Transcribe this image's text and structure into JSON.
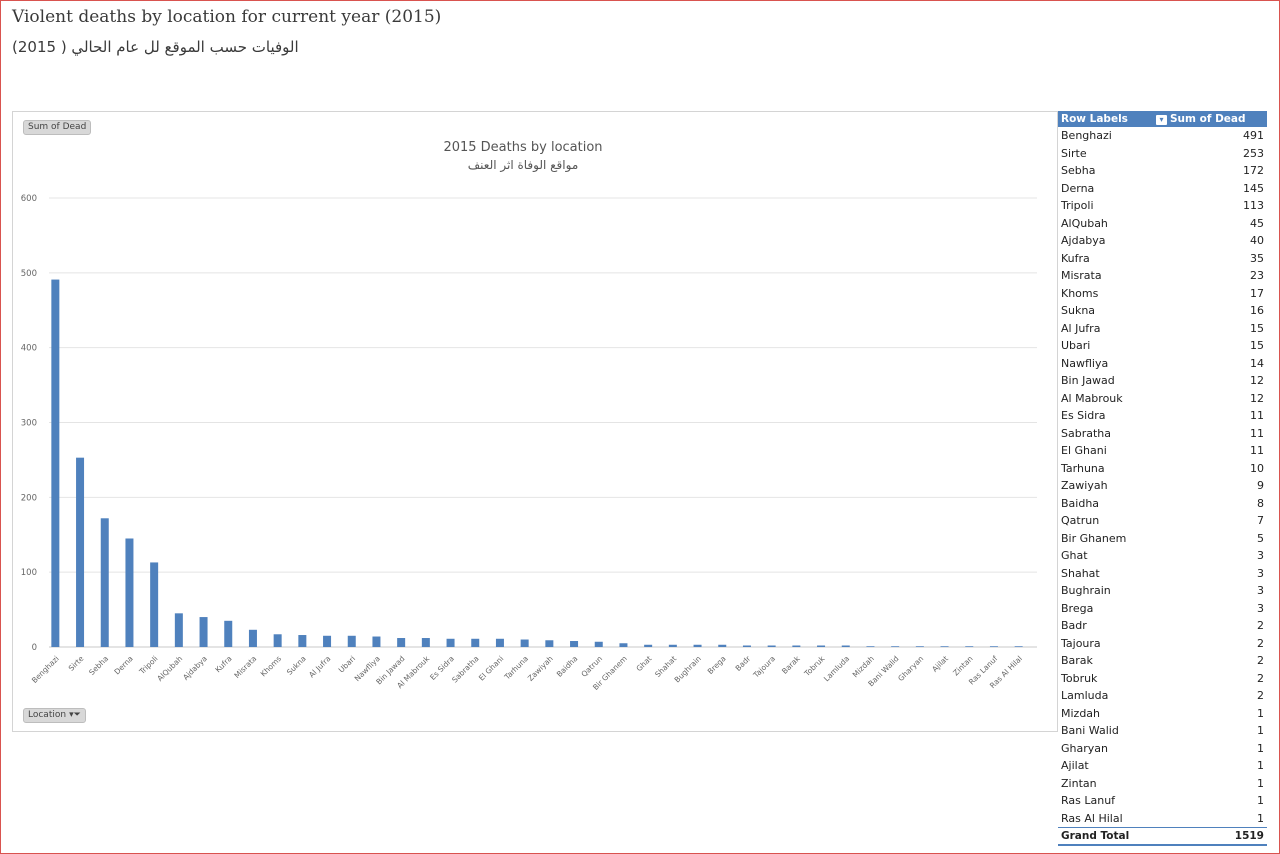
{
  "page": {
    "title": "Violent deaths by location for current year (2015)",
    "subtitle": "الوفيات حسب الموقع لل عام الحالي ( 2015)"
  },
  "chart_controls": {
    "value_field": "Sum of Dead",
    "axis_field": "Location"
  },
  "chart_data": {
    "type": "bar",
    "title": "2015 Deaths by location",
    "subtitle": "مواقع الوفاة اثر العنف",
    "xlabel": "",
    "ylabel": "",
    "ylim": [
      0,
      600
    ],
    "yticks": [
      0,
      100,
      200,
      300,
      400,
      500,
      600
    ],
    "grid": true,
    "legend": "none",
    "bar_color": "#4f81bd",
    "categories": [
      "Benghazi",
      "Sirte",
      "Sebha",
      "Derna",
      "Tripoli",
      "AlQubah",
      "Ajdabya",
      "Kufra",
      "Misrata",
      "Khoms",
      "Sukna",
      "Al Jufra",
      "Ubari",
      "Nawfliya",
      "Bin Jawad",
      "Al Mabrouk",
      "Es Sidra",
      "Sabratha",
      "El Ghani",
      "Tarhuna",
      "Zawiyah",
      "Baidha",
      "Qatrun",
      "Bir Ghanem",
      "Ghat",
      "Shahat",
      "Bughrain",
      "Brega",
      "Badr",
      "Tajoura",
      "Barak",
      "Tobruk",
      "Lamluda",
      "Mizdah",
      "Bani Walid",
      "Gharyan",
      "Ajilat",
      "Zintan",
      "Ras Lanuf",
      "Ras Al Hilal"
    ],
    "values": [
      491,
      253,
      172,
      145,
      113,
      45,
      40,
      35,
      23,
      17,
      16,
      15,
      15,
      14,
      12,
      12,
      11,
      11,
      11,
      10,
      9,
      8,
      7,
      5,
      3,
      3,
      3,
      3,
      2,
      2,
      2,
      2,
      2,
      1,
      1,
      1,
      1,
      1,
      1,
      1
    ]
  },
  "pivot_table": {
    "header_row_labels": "Row Labels",
    "header_sum": "Sum of Dead",
    "header_color": "#4f81bd",
    "grand_total_label": "Grand Total",
    "grand_total_value": "1519"
  }
}
